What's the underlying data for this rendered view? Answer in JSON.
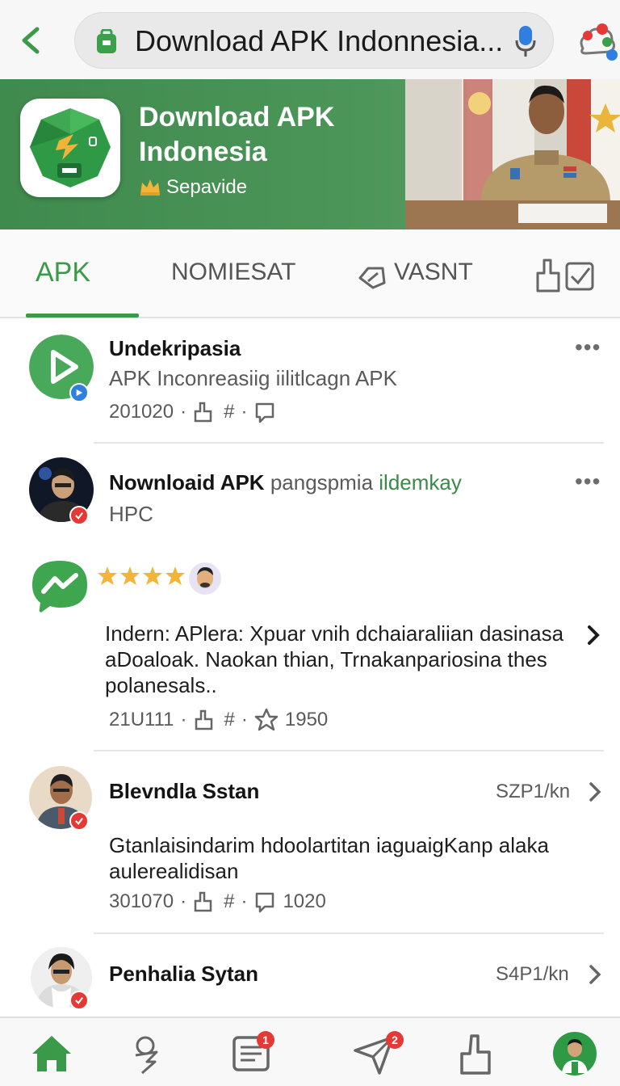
{
  "address_bar": {
    "title": "Download APK Indonnesia..."
  },
  "banner": {
    "app_title": "Download APK Indonesia",
    "publisher": "Sepavide"
  },
  "tabs": [
    {
      "label": "APK"
    },
    {
      "label": "NOMIESAT"
    },
    {
      "label": "VASNT"
    }
  ],
  "feed": [
    {
      "name": "Undekripasia",
      "subtitle": "APK Inconreasiig iilitlcagn APK",
      "date": "201020",
      "reactions": "#"
    },
    {
      "name": "Nownloaid APK",
      "name_suffix": "pangspmia",
      "name_link": "ildemkay",
      "subtitle": "HPC"
    },
    {
      "text": "Indern: APlera: Xpuar vnih dchaiaraliian dasinasa aDoaloak. Naokan thian, Trnakanpariosina thes polanesals..",
      "date": "21U111",
      "reactions": "#",
      "stars_label": "1950",
      "rating": 4
    },
    {
      "name": "Blevndla Sstan",
      "right_meta": "SZP1/kn",
      "text": "Gtanlaisindarim hdoolartitan iaguaigKanp alaka aulerealidisan",
      "date": "301070",
      "reactions": "#",
      "comments": "1020"
    },
    {
      "name": "Penhalia Sytan",
      "right_meta": "S4P1/kn"
    }
  ],
  "bottom_nav": {
    "messages_badge": "1",
    "send_badge": "2"
  },
  "colors": {
    "brand_green": "#3a9a49",
    "banner_green": "#4b9558",
    "badge_red": "#e53935",
    "verified_blue": "#2f7fe0"
  }
}
